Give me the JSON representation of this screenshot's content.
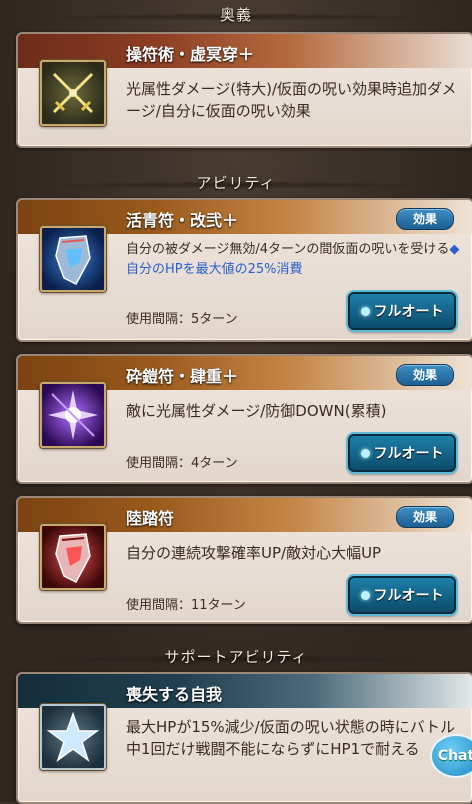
{
  "colors": {
    "panel_bg": "#efe6de",
    "title_red": "#8c3d23",
    "title_brown": "#9a5a1c",
    "title_blue": "#1f3f4f",
    "cost_blue": "#2a5fc9",
    "button_blue": "#1d7fa8"
  },
  "ougi": {
    "header": "奥義",
    "name": "操符術・虚冥穿＋",
    "description": "光属性ダメージ(特大)/仮面の呪い効果時追加ダメージ/自分に仮面の呪い効果",
    "icon": "crossed-swords-icon"
  },
  "abilities": {
    "header": "アビリティ",
    "items": [
      {
        "name": "活青符・改弐＋",
        "effect_button": "効果",
        "description": "自分の被ダメージ無効/4ターンの間仮面の呪いを受ける",
        "cost_text": "◆自分のHPを最大値の25%消費",
        "interval": "使用間隔：5ターン",
        "fullauto_button": "フルオート",
        "icon": "blue-mask-icon"
      },
      {
        "name": "砕鎧符・肆重＋",
        "effect_button": "効果",
        "description": "敵に光属性ダメージ/防御DOWN(累積)",
        "interval": "使用間隔：4ターン",
        "fullauto_button": "フルオート",
        "icon": "purple-burst-icon"
      },
      {
        "name": "陸踏符",
        "effect_button": "効果",
        "description": "自分の連続攻撃確率UP/敵対心大幅UP",
        "interval": "使用間隔：11ターン",
        "fullauto_button": "フルオート",
        "icon": "red-mask-icon"
      }
    ]
  },
  "support": {
    "header": "サポートアビリティ",
    "name": "喪失する自我",
    "description": "最大HPが15%減少/仮面の呪い状態の時にバトル中1回だけ戦闘不能にならずにHP1で耐える",
    "icon": "star-icon"
  },
  "chat_button": "Chat"
}
